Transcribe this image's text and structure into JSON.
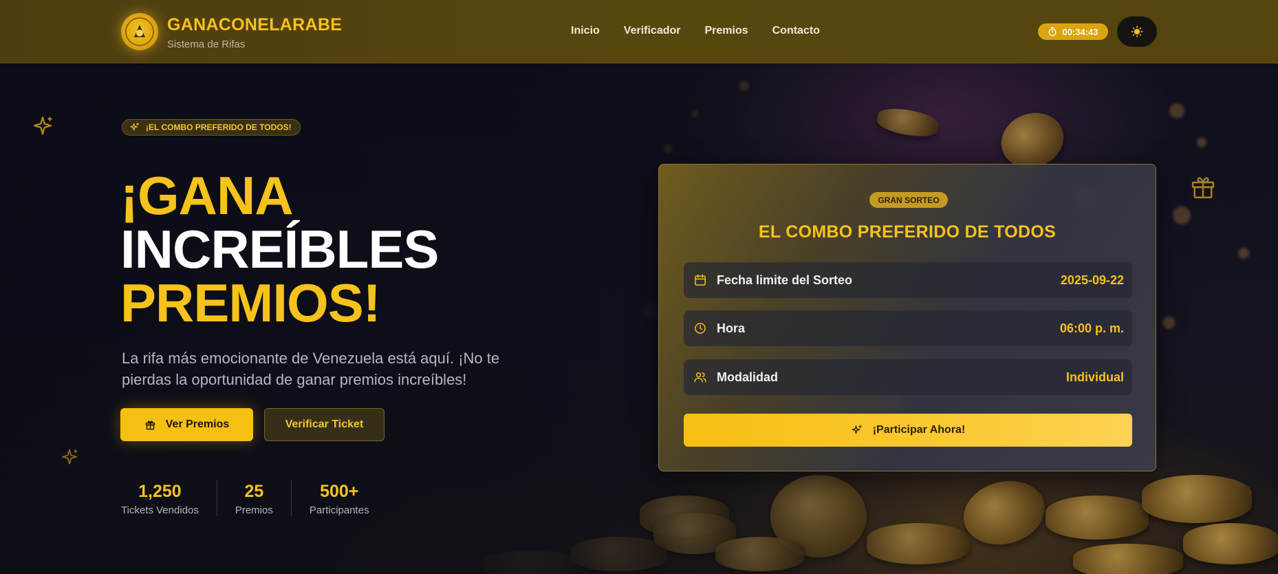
{
  "header": {
    "brand_name": "GANACONELARABE",
    "brand_subtitle": "Sistema de Rifas",
    "logo_text": "GANACON EL ARABE",
    "nav": [
      "Inicio",
      "Verificador",
      "Premios",
      "Contacto"
    ],
    "timer": "00:34:43"
  },
  "hero": {
    "tag": "¡EL COMBO PREFERIDO DE TODOS!",
    "headline_line1": "¡GANA",
    "headline_line2": "INCREÍBLES",
    "headline_line3": "PREMIOS!",
    "lead": "La rifa más emocionante de Venezuela está aquí. ¡No te pierdas la oportunidad de ganar premios increíbles!",
    "primary_button": "Ver Premios",
    "secondary_button": "Verificar Ticket",
    "stats": [
      {
        "value": "1,250",
        "label": "Tickets Vendidos"
      },
      {
        "value": "25",
        "label": "Premios"
      },
      {
        "value": "500+",
        "label": "Participantes"
      }
    ]
  },
  "card": {
    "badge": "GRAN SORTEO",
    "title": "EL COMBO PREFERIDO DE TODOS",
    "rows": [
      {
        "icon": "calendar-icon",
        "label": "Fecha limite del Sorteo",
        "value": "2025-09-22"
      },
      {
        "icon": "clock-icon",
        "label": "Hora",
        "value": "06:00 p. m."
      },
      {
        "icon": "users-icon",
        "label": "Modalidad",
        "value": "Individual"
      }
    ],
    "cta": "¡Participar Ahora!"
  },
  "colors": {
    "accent": "#f6c21c",
    "header_bg": "#55440f",
    "page_bg": "#0d0f19"
  }
}
